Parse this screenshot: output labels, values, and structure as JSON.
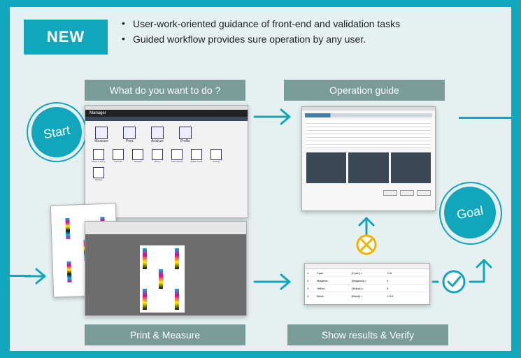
{
  "badge": "NEW",
  "bullets": [
    "User-work-oriented guidance of front-end and validation tasks",
    "Guided workflow provides sure operation by any user."
  ],
  "labels": {
    "what_to_do": "What do you want to do ?",
    "operation_guide": "Operation guide",
    "print_measure": "Print & Measure",
    "show_results": "Show results & Verify"
  },
  "start": "Start",
  "goal": "Goal",
  "colors": {
    "accent": "#12a6bd",
    "panel": "#e6f0f1",
    "label_bg": "#7a9c98",
    "warn": "#f0b400"
  },
  "app_screenshot": {
    "title": "Manager",
    "tiles_row1": [
      "Measure",
      "Print",
      "Analyze",
      "Profile"
    ],
    "tiles_row2": [
      "Patch & Setup",
      "Compare",
      "Variation",
      "History",
      "Color Report",
      "Quick Check",
      "Printing",
      "Settings"
    ]
  },
  "results_table": {
    "rows": [
      [
        "1",
        "Cyan",
        "[Cyan] =",
        "-0.8"
      ],
      [
        "2",
        "Magenta",
        "[Magenta] =",
        "0"
      ],
      [
        "3",
        "Yellow",
        "[Yellow] =",
        "0"
      ],
      [
        "4",
        "Black",
        "[Black] =",
        "-0.15"
      ]
    ]
  }
}
